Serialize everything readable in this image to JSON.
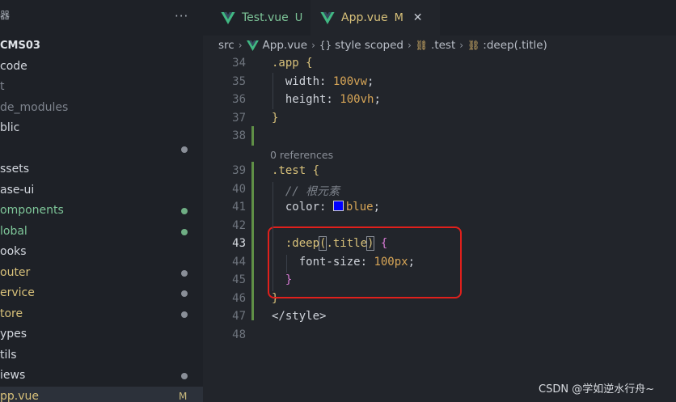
{
  "sidebar": {
    "header_char": "器",
    "more_label": "···",
    "items": [
      {
        "label": "CMS03",
        "color": "root",
        "dot": "none"
      },
      {
        "label": "code",
        "color": "normal",
        "dot": "none"
      },
      {
        "label": "t",
        "color": "dim",
        "dot": "none"
      },
      {
        "label": "de_modules",
        "color": "dim",
        "dot": "none"
      },
      {
        "label": "blic",
        "color": "normal",
        "dot": "none"
      },
      {
        "label": "",
        "color": "normal",
        "dot": "grey"
      },
      {
        "label": "ssets",
        "color": "normal",
        "dot": "none"
      },
      {
        "label": "ase-ui",
        "color": "normal",
        "dot": "none"
      },
      {
        "label": "omponents",
        "color": "green",
        "dot": "green"
      },
      {
        "label": "lobal",
        "color": "green",
        "dot": "green"
      },
      {
        "label": "ooks",
        "color": "normal",
        "dot": "none"
      },
      {
        "label": "outer",
        "color": "yellow",
        "dot": "grey"
      },
      {
        "label": "ervice",
        "color": "yellow",
        "dot": "grey"
      },
      {
        "label": "tore",
        "color": "yellow",
        "dot": "grey"
      },
      {
        "label": "ypes",
        "color": "normal",
        "dot": "none"
      },
      {
        "label": "tils",
        "color": "normal",
        "dot": "none"
      },
      {
        "label": "iews",
        "color": "normal",
        "dot": "grey"
      },
      {
        "label": "pp.vue",
        "color": "yellow",
        "dot": "none",
        "badge": "M"
      }
    ]
  },
  "tabs": [
    {
      "label": "Test.vue",
      "badge": "U",
      "label_color": "#7ec699",
      "badge_color": "#7ec699",
      "active": false
    },
    {
      "label": "App.vue",
      "badge": "M",
      "label_color": "#d8c17a",
      "badge_color": "#d8c17a",
      "active": true,
      "close": "✕"
    }
  ],
  "breadcrumb": {
    "items": [
      {
        "label": "src",
        "icon": "none"
      },
      {
        "label": "App.vue",
        "icon": "vue-icon"
      },
      {
        "label": "style scoped",
        "icon": "braces-icon",
        "glyph": "{}"
      },
      {
        "label": ".test",
        "icon": "css-selector-icon",
        "glyph": "⛓"
      },
      {
        "label": ":deep(.title)",
        "icon": "css-selector-icon",
        "glyph": "⛓"
      }
    ],
    "separator": "›"
  },
  "editor": {
    "codelens": "0 references",
    "active_line": 43,
    "lines": [
      {
        "n": "34",
        "tokens": [
          {
            "t": ".app",
            "c": "sel"
          },
          {
            "t": " "
          },
          {
            "t": "{",
            "c": "brace"
          }
        ]
      },
      {
        "n": "35",
        "tokens": [
          {
            "t": "  width: ",
            "c": "prop"
          },
          {
            "t": "100vw",
            "c": "num"
          },
          {
            "t": ";"
          }
        ]
      },
      {
        "n": "36",
        "tokens": [
          {
            "t": "  height: ",
            "c": "prop"
          },
          {
            "t": "100vh",
            "c": "num"
          },
          {
            "t": ";"
          }
        ]
      },
      {
        "n": "37",
        "tokens": [
          {
            "t": "}",
            "c": "brace"
          }
        ]
      },
      {
        "n": "38",
        "tokens": []
      },
      {
        "n": "39",
        "tokens": [
          {
            "t": ".test",
            "c": "sel"
          },
          {
            "t": " "
          },
          {
            "t": "{",
            "c": "brace"
          }
        ]
      },
      {
        "n": "40",
        "tokens": [
          {
            "t": "  // 根元素",
            "c": "cmt"
          }
        ]
      },
      {
        "n": "41",
        "tokens": [
          {
            "t": "  color: ",
            "c": "prop"
          },
          {
            "t": "blue",
            "c": "num",
            "swatch": true
          },
          {
            "t": ";"
          }
        ]
      },
      {
        "n": "42",
        "tokens": []
      },
      {
        "n": "43",
        "tokens": [
          {
            "t": "  :deep",
            "c": "sel"
          },
          {
            "t": "(",
            "c": "sel",
            "box": true
          },
          {
            "t": ".title",
            "c": "sel"
          },
          {
            "t": ")",
            "c": "sel",
            "box": true
          },
          {
            "t": " "
          },
          {
            "t": "{",
            "c": "pink"
          }
        ]
      },
      {
        "n": "44",
        "tokens": [
          {
            "t": "    font-size: ",
            "c": "prop"
          },
          {
            "t": "100px",
            "c": "num"
          },
          {
            "t": ";"
          }
        ]
      },
      {
        "n": "45",
        "tokens": [
          {
            "t": "  }",
            "c": "pink"
          }
        ]
      },
      {
        "n": "46",
        "tokens": [
          {
            "t": "}",
            "c": "brace"
          }
        ]
      },
      {
        "n": "47",
        "tokens": [
          {
            "t": "</style>",
            "c": "tag"
          }
        ]
      },
      {
        "n": "48",
        "tokens": []
      }
    ]
  },
  "watermark": "CSDN @学如逆水行舟~"
}
